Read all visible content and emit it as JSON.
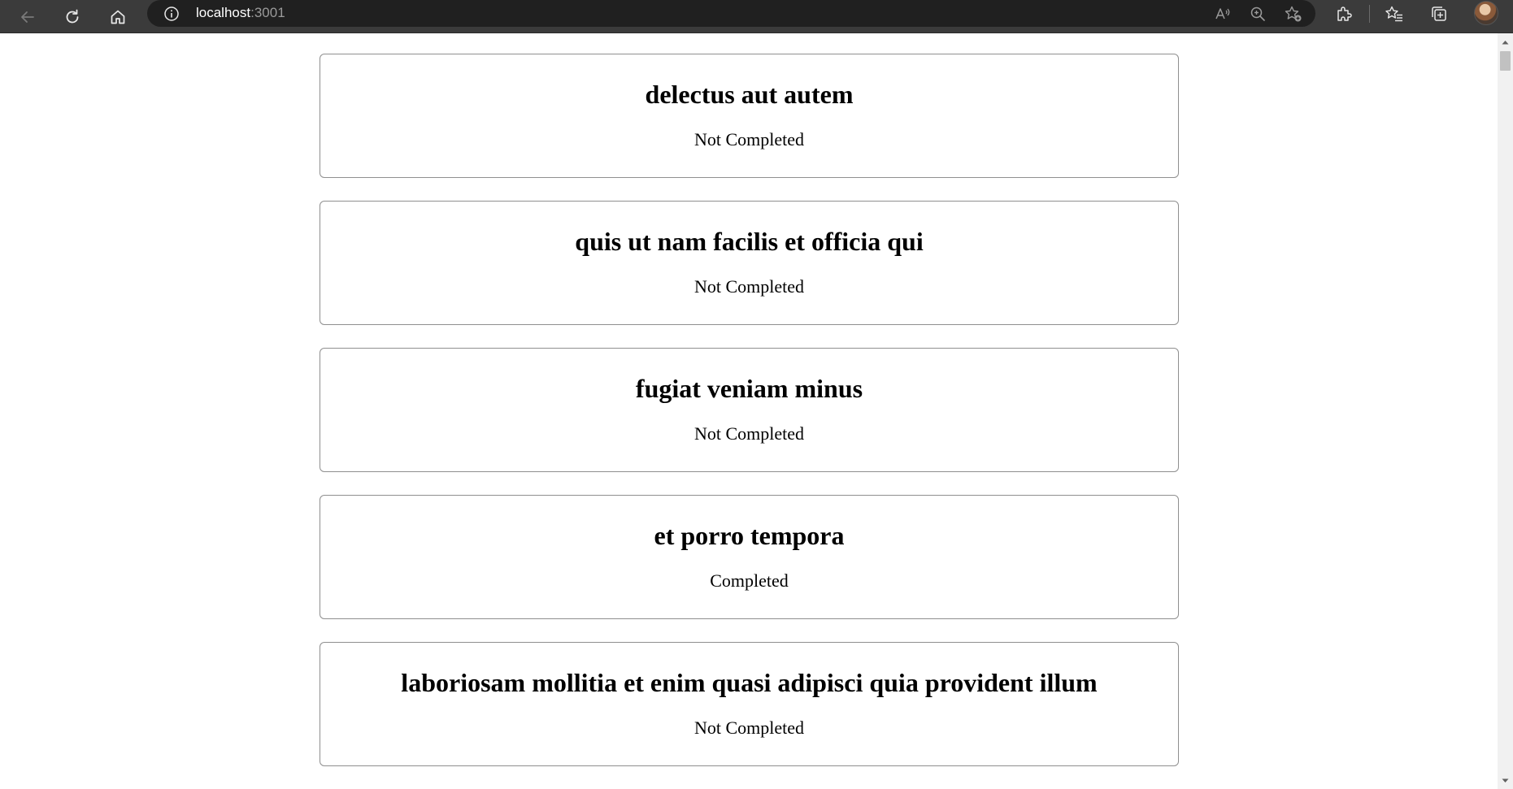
{
  "browser": {
    "url_host": "localhost",
    "url_port": ":3001",
    "icons": [
      "back-arrow-icon",
      "refresh-icon",
      "home-icon",
      "info-icon",
      "read-aloud-icon",
      "zoom-icon",
      "add-favorite-icon",
      "extensions-icon",
      "favorites-icon",
      "collections-icon",
      "profile-avatar"
    ]
  },
  "todos": [
    {
      "title": "delectus aut autem",
      "status": "Not Completed"
    },
    {
      "title": "quis ut nam facilis et officia qui",
      "status": "Not Completed"
    },
    {
      "title": "fugiat veniam minus",
      "status": "Not Completed"
    },
    {
      "title": "et porro tempora",
      "status": "Completed"
    },
    {
      "title": "laboriosam mollitia et enim quasi adipisci quia provident illum",
      "status": "Not Completed"
    }
  ],
  "colors": {
    "toolbar_bg": "#3b3b3b",
    "address_bg": "#202020",
    "card_border": "#8f8f8f",
    "page_bg": "#ffffff"
  }
}
